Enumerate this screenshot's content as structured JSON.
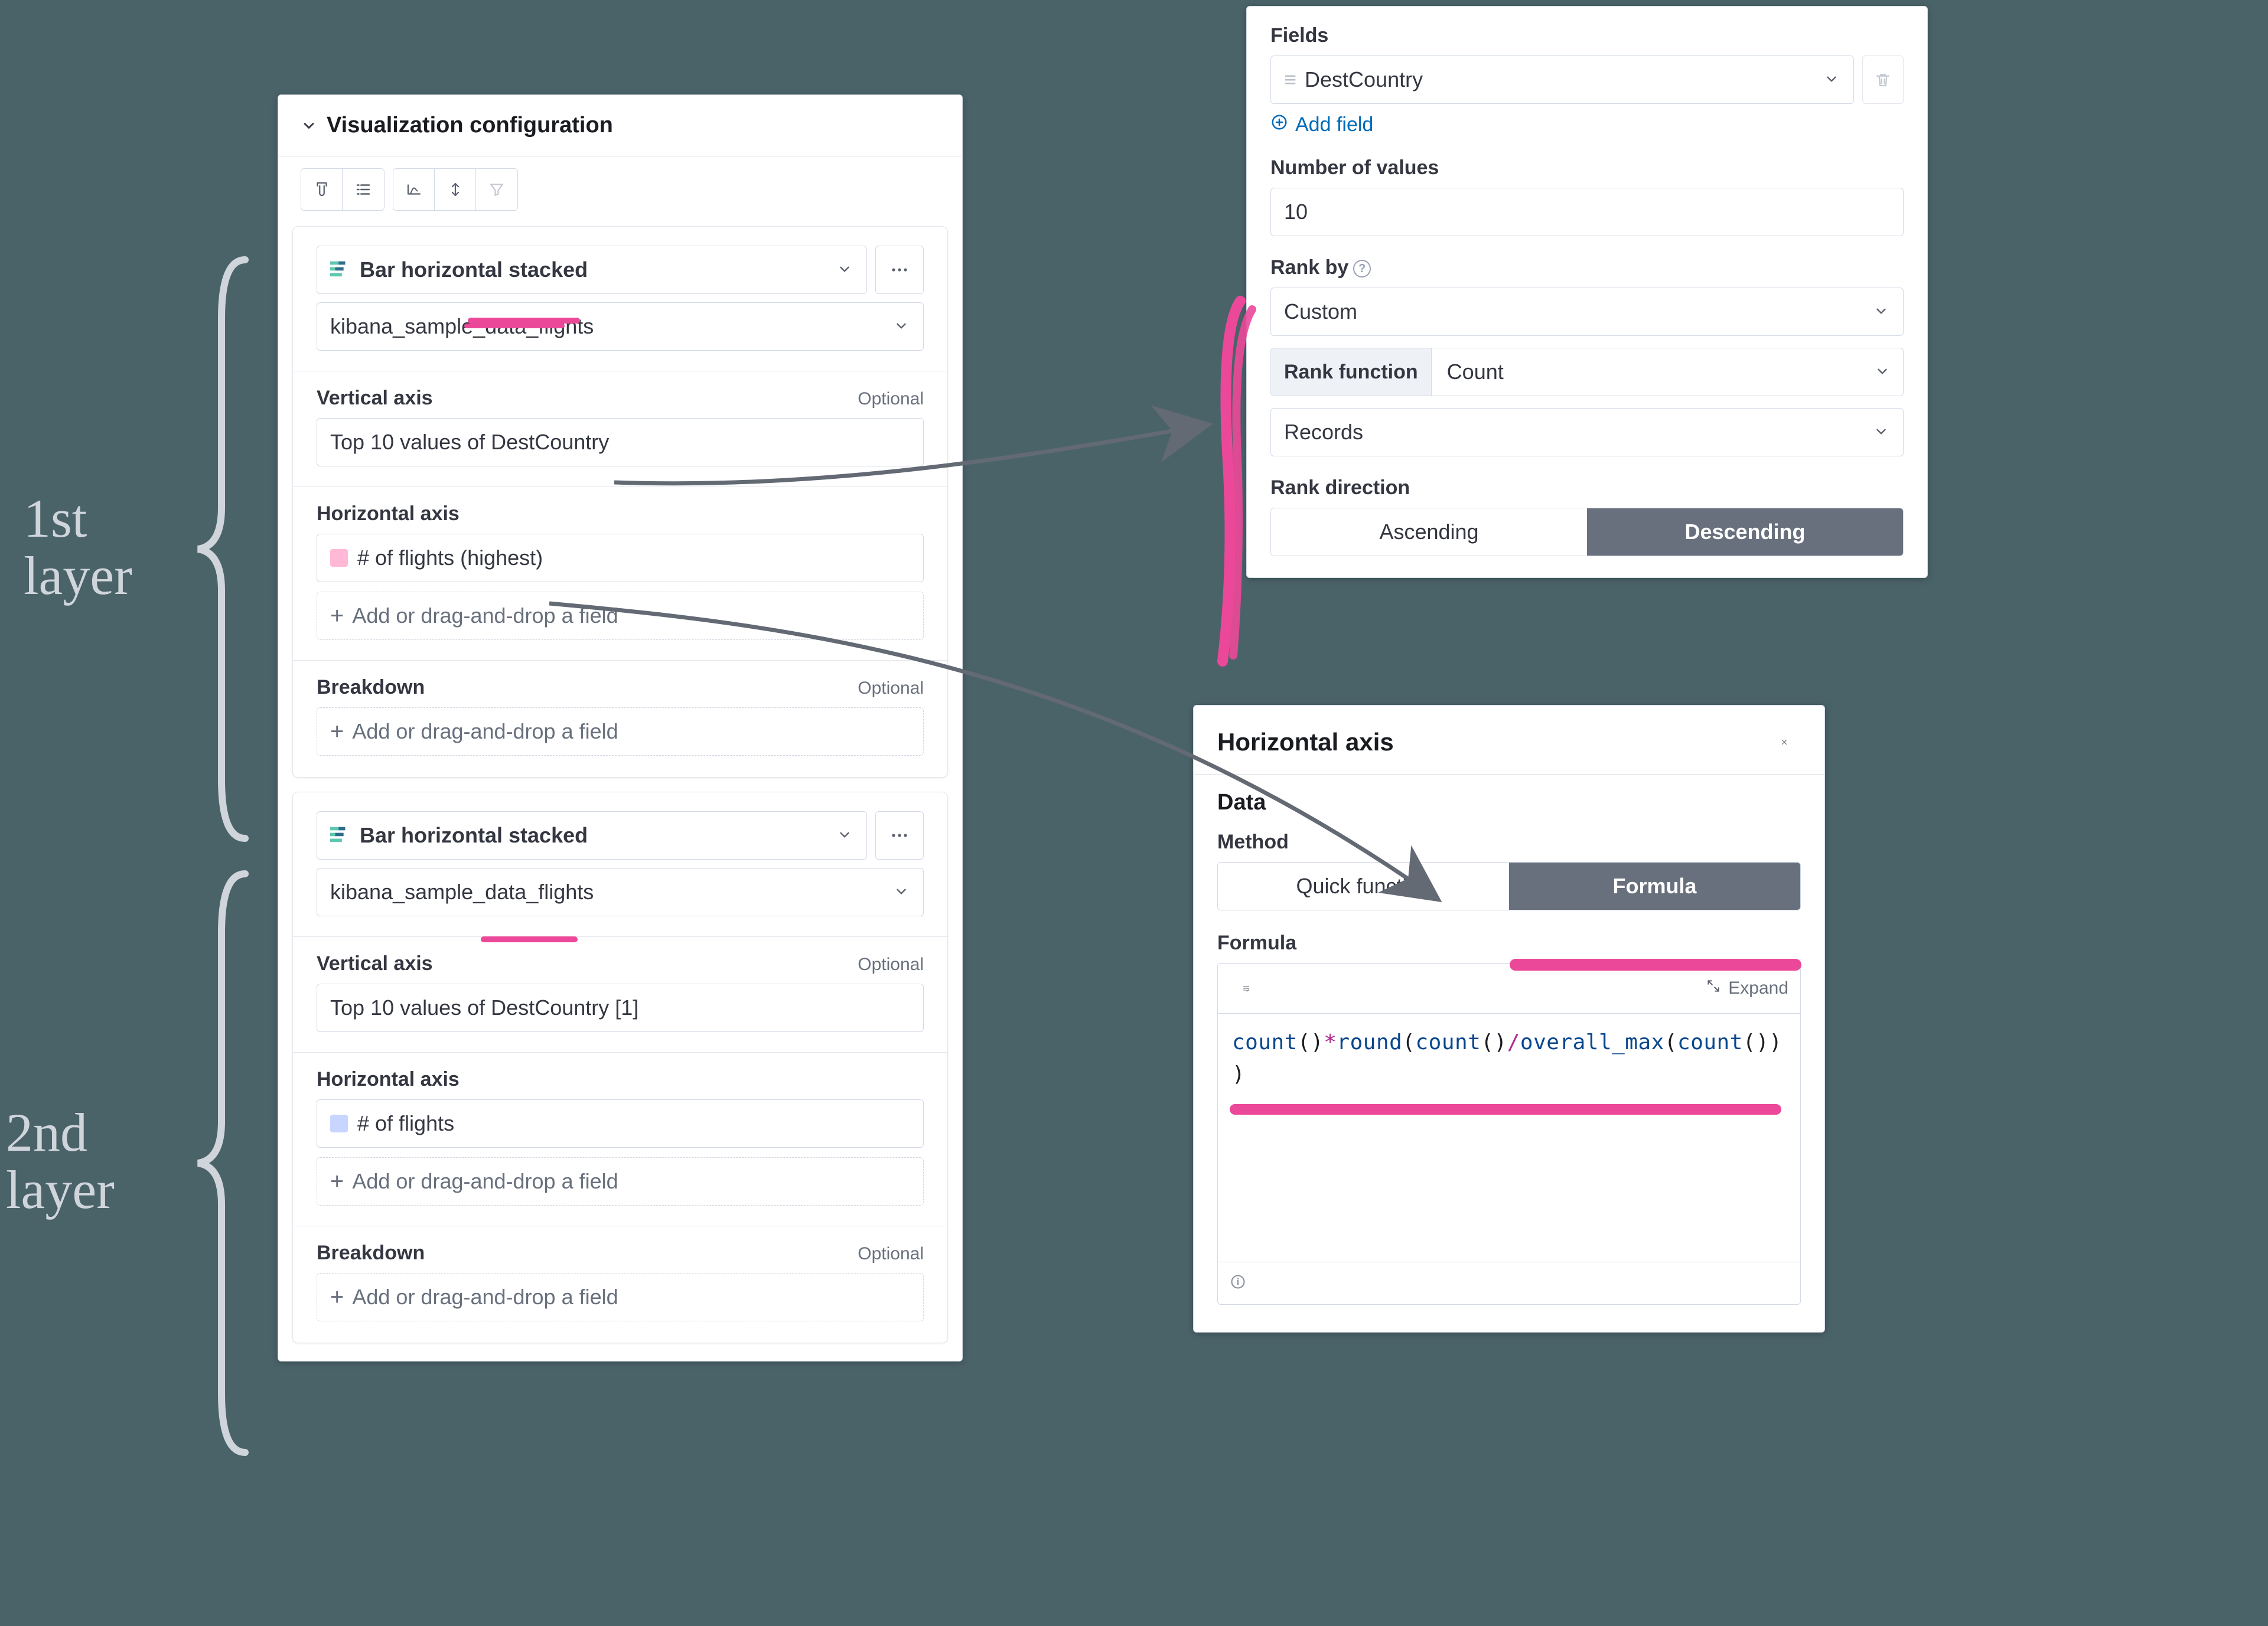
{
  "hand": {
    "layer1": "1st\nlayer",
    "layer2": "2nd\nlayer"
  },
  "panel_main": {
    "title": "Visualization configuration",
    "layer1": {
      "chart_type": "Bar horizontal stacked",
      "dataset": "kibana_sample_data_flights",
      "vert_label": "Vertical axis",
      "vert_value": "Top 10 values of DestCountry",
      "horz_label": "Horizontal axis",
      "horz_chip": "# of flights (highest)",
      "add_field": "Add or drag-and-drop a field",
      "breakdown_label": "Breakdown",
      "optional": "Optional"
    },
    "layer2": {
      "chart_type": "Bar horizontal stacked",
      "dataset": "kibana_sample_data_flights",
      "vert_label": "Vertical axis",
      "vert_value": "Top 10 values of DestCountry [1]",
      "horz_label": "Horizontal axis",
      "horz_chip": "# of flights",
      "add_field": "Add or drag-and-drop a field",
      "breakdown_label": "Breakdown",
      "optional": "Optional"
    }
  },
  "panel_fields": {
    "fields_label": "Fields",
    "field_value": "DestCountry",
    "add_field": "Add field",
    "num_values_label": "Number of values",
    "num_values": "10",
    "rank_by_label": "Rank by",
    "rank_by_value": "Custom",
    "rank_fn_label": "Rank function",
    "rank_fn_value": "Count",
    "rank_fn_sub": "Records",
    "rank_dir_label": "Rank direction",
    "ascending": "Ascending",
    "descending": "Descending"
  },
  "panel_formula": {
    "title": "Horizontal axis",
    "data_label": "Data",
    "method_label": "Method",
    "quick_fn": "Quick function",
    "formula_tab": "Formula",
    "formula_label": "Formula",
    "expand": "Expand",
    "code": {
      "f1": "count",
      "p1": "()",
      "op1": "*",
      "f2": "round",
      "p2": "(",
      "f3": "count",
      "p3": "()",
      "op2": "/",
      "f4": "overall_max",
      "p4": "(",
      "f5": "count",
      "p5": "()))"
    }
  }
}
